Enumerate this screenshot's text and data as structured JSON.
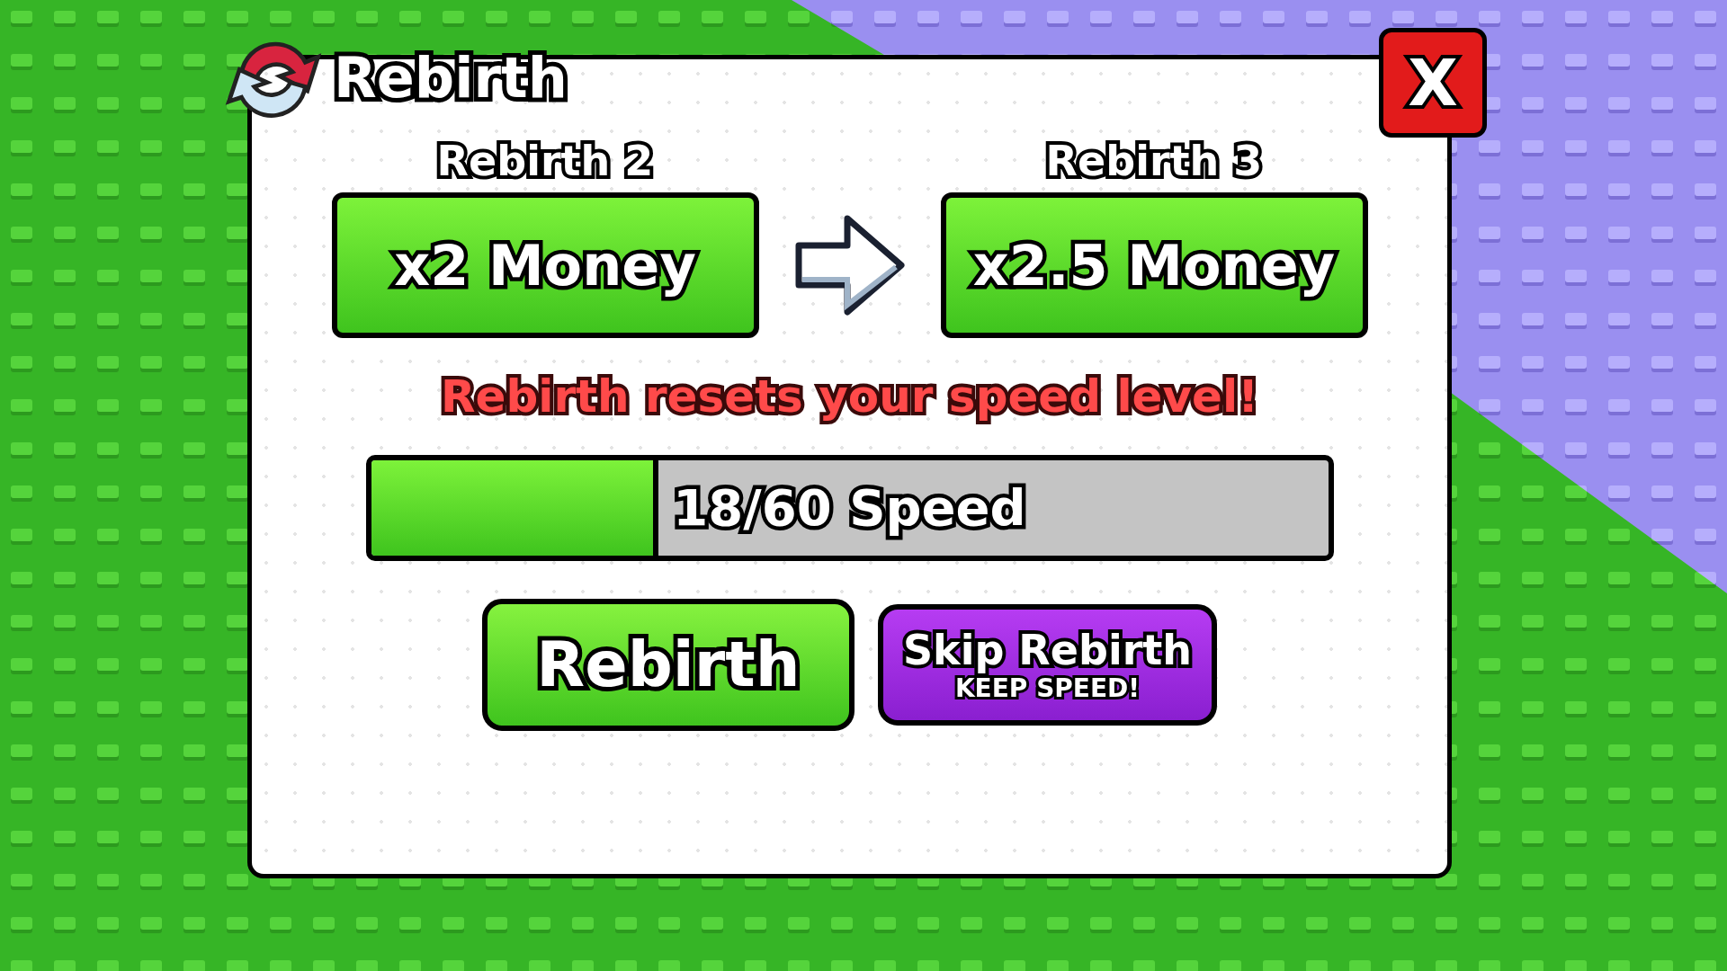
{
  "window": {
    "title": "Rebirth",
    "close_label": "X"
  },
  "rewards": [
    {
      "label": "Rebirth 2",
      "reward": "x2 Money"
    },
    {
      "label": "Rebirth 3",
      "reward": "x2.5 Money"
    }
  ],
  "warning": "Rebirth resets your speed level!",
  "progress": {
    "level": 0.3,
    "reading": "18/60 Speed"
  },
  "buttons": [
    {
      "kind": "primary",
      "label": "Rebirth"
    },
    {
      "kind": "skip",
      "label": "Skip Rebirth",
      "sublabel": "KEEP SPEED!"
    }
  ]
}
